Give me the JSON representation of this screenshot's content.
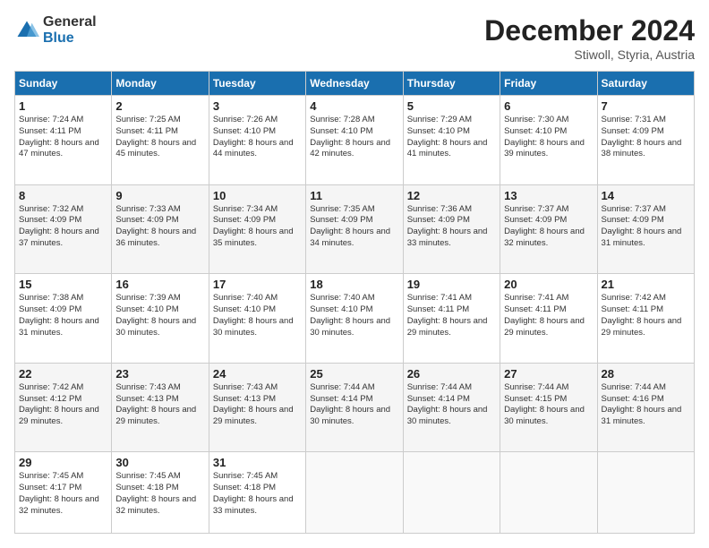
{
  "header": {
    "logo_general": "General",
    "logo_blue": "Blue",
    "month_title": "December 2024",
    "location": "Stiwoll, Styria, Austria"
  },
  "days_of_week": [
    "Sunday",
    "Monday",
    "Tuesday",
    "Wednesday",
    "Thursday",
    "Friday",
    "Saturday"
  ],
  "weeks": [
    [
      {
        "day": "1",
        "sunrise": "7:24 AM",
        "sunset": "4:11 PM",
        "daylight": "8 hours and 47 minutes."
      },
      {
        "day": "2",
        "sunrise": "7:25 AM",
        "sunset": "4:11 PM",
        "daylight": "8 hours and 45 minutes."
      },
      {
        "day": "3",
        "sunrise": "7:26 AM",
        "sunset": "4:10 PM",
        "daylight": "8 hours and 44 minutes."
      },
      {
        "day": "4",
        "sunrise": "7:28 AM",
        "sunset": "4:10 PM",
        "daylight": "8 hours and 42 minutes."
      },
      {
        "day": "5",
        "sunrise": "7:29 AM",
        "sunset": "4:10 PM",
        "daylight": "8 hours and 41 minutes."
      },
      {
        "day": "6",
        "sunrise": "7:30 AM",
        "sunset": "4:10 PM",
        "daylight": "8 hours and 39 minutes."
      },
      {
        "day": "7",
        "sunrise": "7:31 AM",
        "sunset": "4:09 PM",
        "daylight": "8 hours and 38 minutes."
      }
    ],
    [
      {
        "day": "8",
        "sunrise": "7:32 AM",
        "sunset": "4:09 PM",
        "daylight": "8 hours and 37 minutes."
      },
      {
        "day": "9",
        "sunrise": "7:33 AM",
        "sunset": "4:09 PM",
        "daylight": "8 hours and 36 minutes."
      },
      {
        "day": "10",
        "sunrise": "7:34 AM",
        "sunset": "4:09 PM",
        "daylight": "8 hours and 35 minutes."
      },
      {
        "day": "11",
        "sunrise": "7:35 AM",
        "sunset": "4:09 PM",
        "daylight": "8 hours and 34 minutes."
      },
      {
        "day": "12",
        "sunrise": "7:36 AM",
        "sunset": "4:09 PM",
        "daylight": "8 hours and 33 minutes."
      },
      {
        "day": "13",
        "sunrise": "7:37 AM",
        "sunset": "4:09 PM",
        "daylight": "8 hours and 32 minutes."
      },
      {
        "day": "14",
        "sunrise": "7:37 AM",
        "sunset": "4:09 PM",
        "daylight": "8 hours and 31 minutes."
      }
    ],
    [
      {
        "day": "15",
        "sunrise": "7:38 AM",
        "sunset": "4:09 PM",
        "daylight": "8 hours and 31 minutes."
      },
      {
        "day": "16",
        "sunrise": "7:39 AM",
        "sunset": "4:10 PM",
        "daylight": "8 hours and 30 minutes."
      },
      {
        "day": "17",
        "sunrise": "7:40 AM",
        "sunset": "4:10 PM",
        "daylight": "8 hours and 30 minutes."
      },
      {
        "day": "18",
        "sunrise": "7:40 AM",
        "sunset": "4:10 PM",
        "daylight": "8 hours and 30 minutes."
      },
      {
        "day": "19",
        "sunrise": "7:41 AM",
        "sunset": "4:11 PM",
        "daylight": "8 hours and 29 minutes."
      },
      {
        "day": "20",
        "sunrise": "7:41 AM",
        "sunset": "4:11 PM",
        "daylight": "8 hours and 29 minutes."
      },
      {
        "day": "21",
        "sunrise": "7:42 AM",
        "sunset": "4:11 PM",
        "daylight": "8 hours and 29 minutes."
      }
    ],
    [
      {
        "day": "22",
        "sunrise": "7:42 AM",
        "sunset": "4:12 PM",
        "daylight": "8 hours and 29 minutes."
      },
      {
        "day": "23",
        "sunrise": "7:43 AM",
        "sunset": "4:13 PM",
        "daylight": "8 hours and 29 minutes."
      },
      {
        "day": "24",
        "sunrise": "7:43 AM",
        "sunset": "4:13 PM",
        "daylight": "8 hours and 29 minutes."
      },
      {
        "day": "25",
        "sunrise": "7:44 AM",
        "sunset": "4:14 PM",
        "daylight": "8 hours and 30 minutes."
      },
      {
        "day": "26",
        "sunrise": "7:44 AM",
        "sunset": "4:14 PM",
        "daylight": "8 hours and 30 minutes."
      },
      {
        "day": "27",
        "sunrise": "7:44 AM",
        "sunset": "4:15 PM",
        "daylight": "8 hours and 30 minutes."
      },
      {
        "day": "28",
        "sunrise": "7:44 AM",
        "sunset": "4:16 PM",
        "daylight": "8 hours and 31 minutes."
      }
    ],
    [
      {
        "day": "29",
        "sunrise": "7:45 AM",
        "sunset": "4:17 PM",
        "daylight": "8 hours and 32 minutes."
      },
      {
        "day": "30",
        "sunrise": "7:45 AM",
        "sunset": "4:18 PM",
        "daylight": "8 hours and 32 minutes."
      },
      {
        "day": "31",
        "sunrise": "7:45 AM",
        "sunset": "4:18 PM",
        "daylight": "8 hours and 33 minutes."
      },
      null,
      null,
      null,
      null
    ]
  ]
}
